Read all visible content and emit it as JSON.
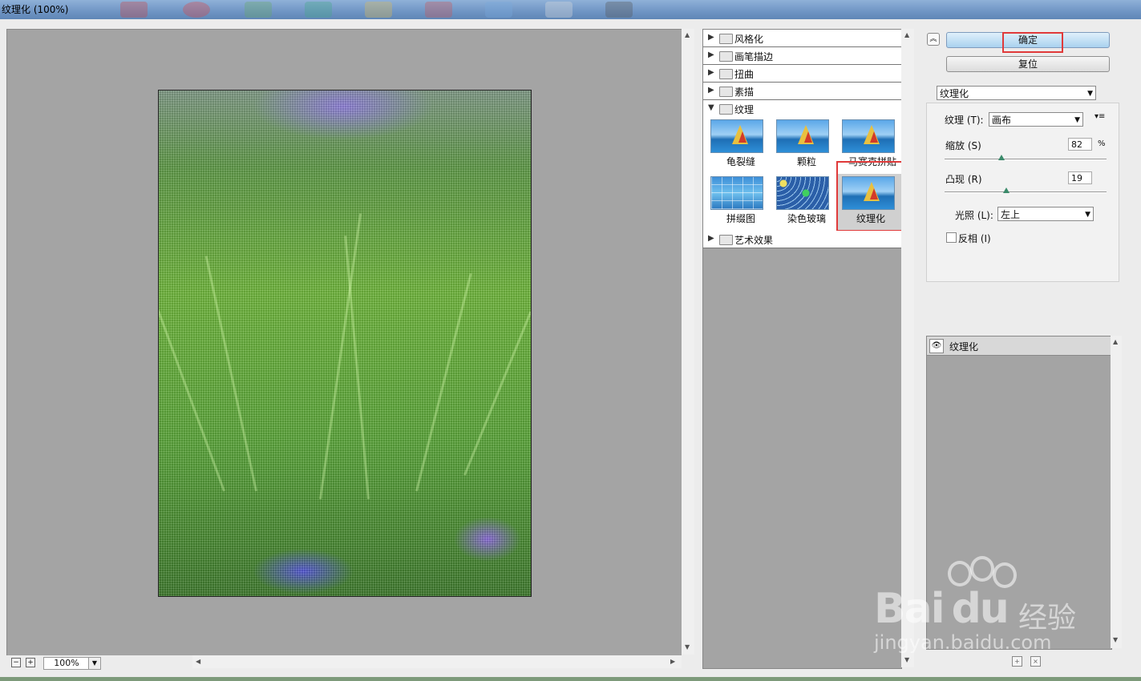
{
  "window": {
    "title": "纹理化 (100%)"
  },
  "preview": {
    "zoom": "100%",
    "zoom_out_symbol": "−",
    "zoom_in_symbol": "+"
  },
  "filter_gallery": {
    "categories": [
      {
        "label": "风格化",
        "expanded": false
      },
      {
        "label": "画笔描边",
        "expanded": false
      },
      {
        "label": "扭曲",
        "expanded": false
      },
      {
        "label": "素描",
        "expanded": false
      },
      {
        "label": "纹理",
        "expanded": true
      },
      {
        "label": "艺术效果",
        "expanded": false
      }
    ],
    "texture_filters": [
      {
        "label": "龟裂缝",
        "icon": "sailboat-thumbnail"
      },
      {
        "label": "颗粒",
        "icon": "sailboat-thumbnail"
      },
      {
        "label": "马赛克拼贴",
        "icon": "sailboat-thumbnail"
      },
      {
        "label": "拼缀图",
        "icon": "tiles-thumbnail"
      },
      {
        "label": "染色玻璃",
        "icon": "stained-glass-thumbnail"
      },
      {
        "label": "纹理化",
        "icon": "sailboat-thumbnail",
        "selected": true
      }
    ]
  },
  "controls": {
    "ok_label": "确定",
    "reset_label": "复位",
    "filter_select": "纹理化",
    "texture_label": "纹理 (T):",
    "texture_value": "画布",
    "scaling_label": "缩放 (S)",
    "scaling_value": "82",
    "scaling_unit": "%",
    "scaling_level": 0.35,
    "relief_label": "凸现 (R)",
    "relief_value": "19",
    "relief_level": 0.38,
    "light_label": "光照 (L):",
    "light_value": "左上",
    "invert_label": "反相 (I)",
    "invert_checked": false
  },
  "layers": {
    "items": [
      {
        "label": "纹理化",
        "visible": true
      }
    ]
  },
  "watermark": {
    "brand": "Bai",
    "brand2": "du",
    "cn": "经验",
    "url": "jingyan.baidu.com"
  },
  "colors": {
    "highlight": "#e03a3a",
    "ok_button": "#a9d2ef",
    "preview_bg": "#a4a4a4"
  }
}
